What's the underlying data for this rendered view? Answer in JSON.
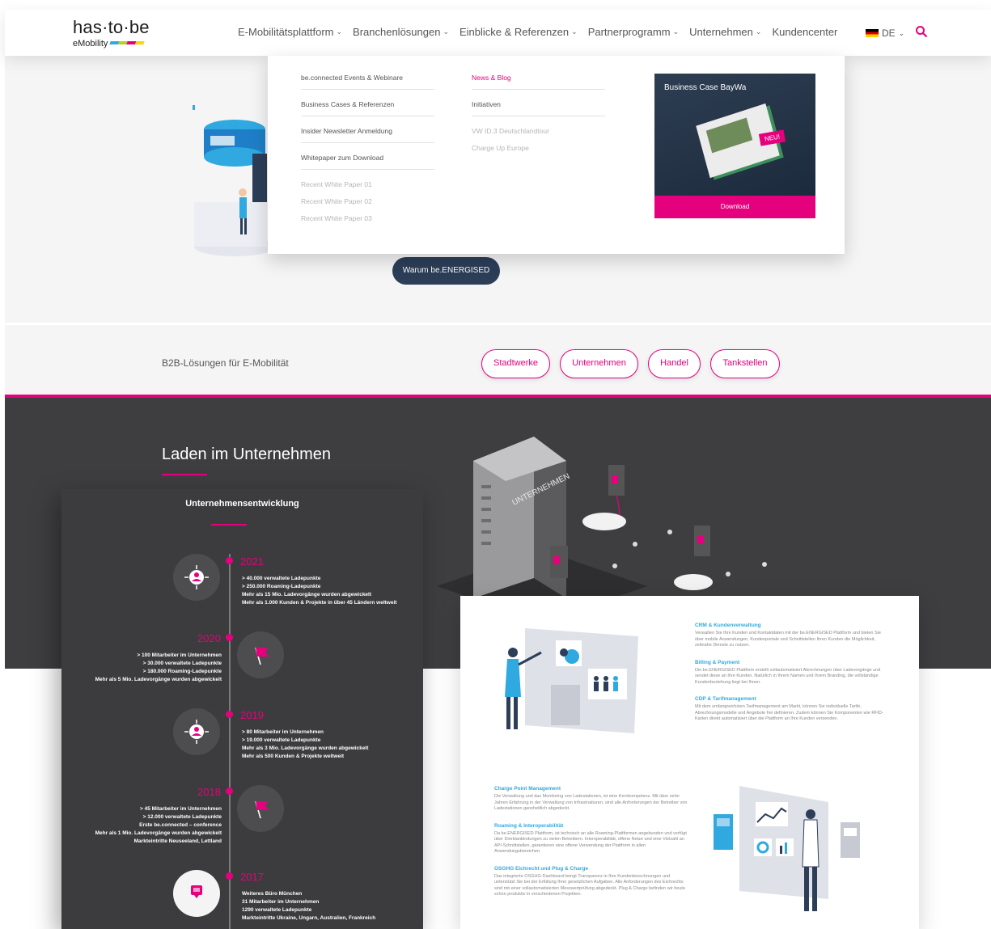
{
  "header": {
    "logo_word": "has·to·be",
    "logo_sub": "eMobility",
    "nav": [
      {
        "label": "E-Mobilitätsplattform"
      },
      {
        "label": "Branchenlösungen"
      },
      {
        "label": "Einblicke & Referenzen"
      },
      {
        "label": "Partnerprogramm"
      },
      {
        "label": "Unternehmen"
      },
      {
        "label": "Kundencenter"
      }
    ],
    "language": "DE"
  },
  "mega_menu": {
    "col1": [
      "be.connected Events & Webinare",
      "Business Cases & Referenzen",
      "Insider Newsletter Anmeldung",
      "Whitepaper zum Download"
    ],
    "col1_sub": [
      "Recent White Paper 01",
      "Recent White Paper 02",
      "Recent White Paper 03"
    ],
    "col2": [
      "News & Blog",
      "Initiativen"
    ],
    "col2_sub": [
      "VW ID.3 Deutschlandtour",
      "Charge Up Europe"
    ],
    "teaser_title": "Business Case BayWa",
    "teaser_badge": "NEU!",
    "teaser_button": "Download"
  },
  "hero": {
    "button": "Warum be.ENERGISED"
  },
  "b2b": {
    "title": "B2B-Lösungen für E-Mobilität",
    "pills": [
      "Stadtwerke",
      "Unternehmen",
      "Handel",
      "Tankstellen"
    ]
  },
  "dark": {
    "title": "Laden im Unternehmen",
    "building_label": "UNTERNEHMEN"
  },
  "timeline": {
    "title": "Unternehmensentwicklung",
    "entries": [
      {
        "year": "2021",
        "lines": [
          "> 40.000 verwaltete Ladepunkte",
          "> 250.000 Roaming-Ladepunkte",
          "Mehr als 15 Mio. Ladevorgänge wurden abgewickelt",
          "Mehr als 1.000 Kunden & Projekte in über 45 Ländern weltweit"
        ]
      },
      {
        "year": "2020",
        "lines": [
          "> 100 Mitarbeiter im Unternehmen",
          "> 30.000 verwaltete Ladepunkte",
          "> 180.000 Roaming-Ladepunkte",
          "Mehr als 5 Mio. Ladevorgänge wurden abgewickelt"
        ]
      },
      {
        "year": "2019",
        "lines": [
          "> 80 Mitarbeiter im Unternehmen",
          "> 19.000 verwaltete Ladepunkte",
          "Mehr als 3 Mio. Ladevorgänge wurden abgewickelt",
          "Mehr als 500 Kunden & Projekte weltweit"
        ]
      },
      {
        "year": "2018",
        "lines": [
          "> 45 Mitarbeiter im Unternehmen",
          "> 12.000 verwaltete Ladepunkte",
          "Erste be.connected – conference",
          "Mehr als 1 Mio. Ladevorgänge wurden abgewickelt",
          "Markteintritte Neuseeland, Lettland"
        ]
      },
      {
        "year": "2017",
        "lines": [
          "Weiteres Büro München",
          "31 Mitarbeiter im Unternehmen",
          "1290 verwaltete Ladepunkte",
          "Markteintritte Ukraine, Ungarn, Australien, Frankreich"
        ]
      }
    ]
  },
  "features": {
    "right": [
      {
        "head": "CRM & Kundenverwaltung",
        "body": "Verwalten Sie Ihre Kunden und Kontaktdaten mit der be.ENERGISED Plattform und bieten Sie über mobile Anwendungen, Kundenportale und Schnittstellen Ihren Kunden die Möglichkeit, zeitnahe Dienste zu nutzen."
      },
      {
        "head": "Billing & Payment",
        "body": "Die be.ENERGISED Plattform erstellt vollautomatisiert Abrechnungen über Ladevorgänge und sendet diese an Ihre Kunden. Natürlich in Ihrem Namen und Ihrem Branding, die vollständige Kundenbeziehung liegt bei Ihnen."
      },
      {
        "head": "CDP & Tarifmanagement",
        "body": "Mit dem umfangreichsten Tarifmanagement am Markt, können Sie individuelle Tarife, Abrechnungsmodelle und Angebote frei definieren. Zudem können Sie Komponenten wie RFID-Karten direkt automatisiert über die Plattform an Ihre Kunden versenden."
      }
    ],
    "left": [
      {
        "head": "Charge Point Management",
        "body": "Die Verwaltung und das Monitoring von Ladestationen, ist eine Kernkompetenz. Mit über zehn Jahren Erfahrung in der Verwaltung von Infrastrukturen, sind alle Anforderungen der Betreiber von Ladestationen ganzheitlich abgedeckt."
      },
      {
        "head": "Roaming & Interoperabilität",
        "body": "Da be.ENERGISED Plattform, ist technisch an alle Roaming-Plattformen angebunden und verfügt über Direktanbindungen zu vielen Betreibern. Interoperabilität, offene Netze und eine Vielzahl an API-Schnittstellen, garantieren eine offene Verwendung der Plattform in allen Anwendungsbereichen."
      },
      {
        "head": "OSGHG Eichrecht und Plug & Charge",
        "body": "Das integrierte OSGHG-Dashboard bringt Transparenz in Ihre Kundenberechnungen und unterstützt Sie bei der Erfüllung Ihrer gesetzlichen Aufgaben. Alle Anforderungen des Eichrechts sind mit einer vollautomatisierten Messwertprüfung abgedeckt. Plug & Charge befinden wir heute schon produktiv in verschiedenen Projekten."
      }
    ]
  },
  "colors": {
    "accent": "#e5007d",
    "dark": "#3e3e40",
    "navy": "#2c3e58",
    "blue": "#2fa9e0"
  }
}
